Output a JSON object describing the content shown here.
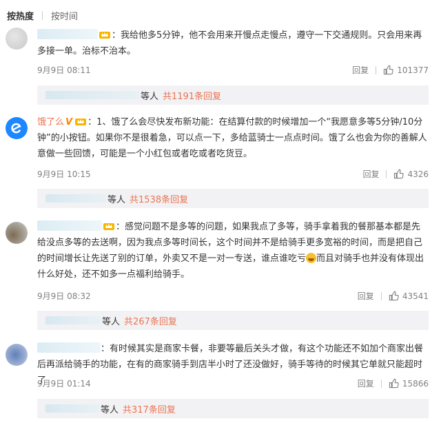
{
  "sort": {
    "hot": "按热度",
    "time": "按时间"
  },
  "comments": [
    {
      "text": "：我给他多5分钟，他不会用来开慢点走慢点，遵守一下交通规则。只会用来再多接一单。治标不治本。",
      "date": "9月9日 08:11",
      "reply": "回复",
      "likes": "101377",
      "sub_who": "等人",
      "sub_count": "共1191条回复"
    },
    {
      "name": "饿了么",
      "v": "V",
      "text_a": "：1、饿了么会尽快发布新功能：在结算付款的时候增加一个“我愿意多等5分钟/10分钟”的小按钮。如果你不是很着急，可以点一下，多给蓝骑士一点点时间。饿了么也会为你的善解人意做一些回馈，可能是一个小红包或者吃或者吃货豆。",
      "date": "9月9日 10:15",
      "reply": "回复",
      "likes": "4326",
      "sub_who": "等人",
      "sub_count": "共1538条回复"
    },
    {
      "text_a": "：感觉问题不是多等的问题，如果我点了多等，骑手拿着我的餐那基本都是先给没点多等的去送啊，因为我点多等时间长，这个时间并不是给骑手更多宽裕的时间，而是把自己的时间增长让先送了别的订单，外卖又不是一对一专送，谁点谁吃亏",
      "text_b": "而且对骑手也并没有体现出什么好处，还不如多一点福利给骑手。",
      "date": "9月9日 08:32",
      "reply": "回复",
      "likes": "43541",
      "sub_who": "等人",
      "sub_count": "共267条回复"
    },
    {
      "text": "：有时候其实是商家卡餐，非要等最后关头才做，有这个功能还不如加个商家出餐后再派给骑手的功能，在有的商家骑手到店半小时了还没做好，骑手等待的时候其它单就只能超时了",
      "date": "9月9日 01:14",
      "reply": "回复",
      "likes": "15866",
      "sub_who": "等人",
      "sub_count": "共317条回复"
    }
  ]
}
